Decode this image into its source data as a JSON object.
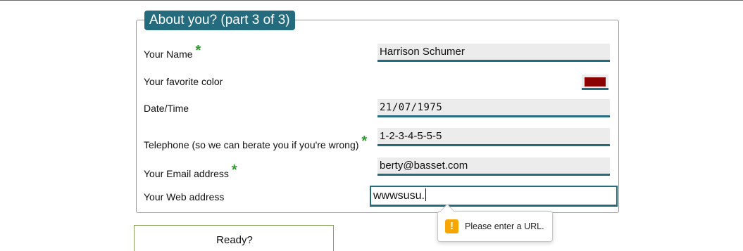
{
  "form": {
    "legend": "About you? (part 3 of 3)",
    "required_marker": "*",
    "fields": [
      {
        "label": "Your Name",
        "value": "Harrison Schumer"
      },
      {
        "label": "Your favorite color",
        "value": "#8b0000"
      },
      {
        "label": "Date/Time",
        "value": "21/07/1975"
      },
      {
        "label": "Telephone (so we can berate you if you're wrong)",
        "value": "1-2-3-4-5-5-5"
      },
      {
        "label": "Your Email address",
        "value": "berty@basset.com"
      },
      {
        "label": "Your Web address",
        "value": "wwwsusu."
      }
    ]
  },
  "validation": {
    "message": "Please enter a URL.",
    "icon": "!"
  },
  "ready": {
    "label": "Ready?"
  }
}
